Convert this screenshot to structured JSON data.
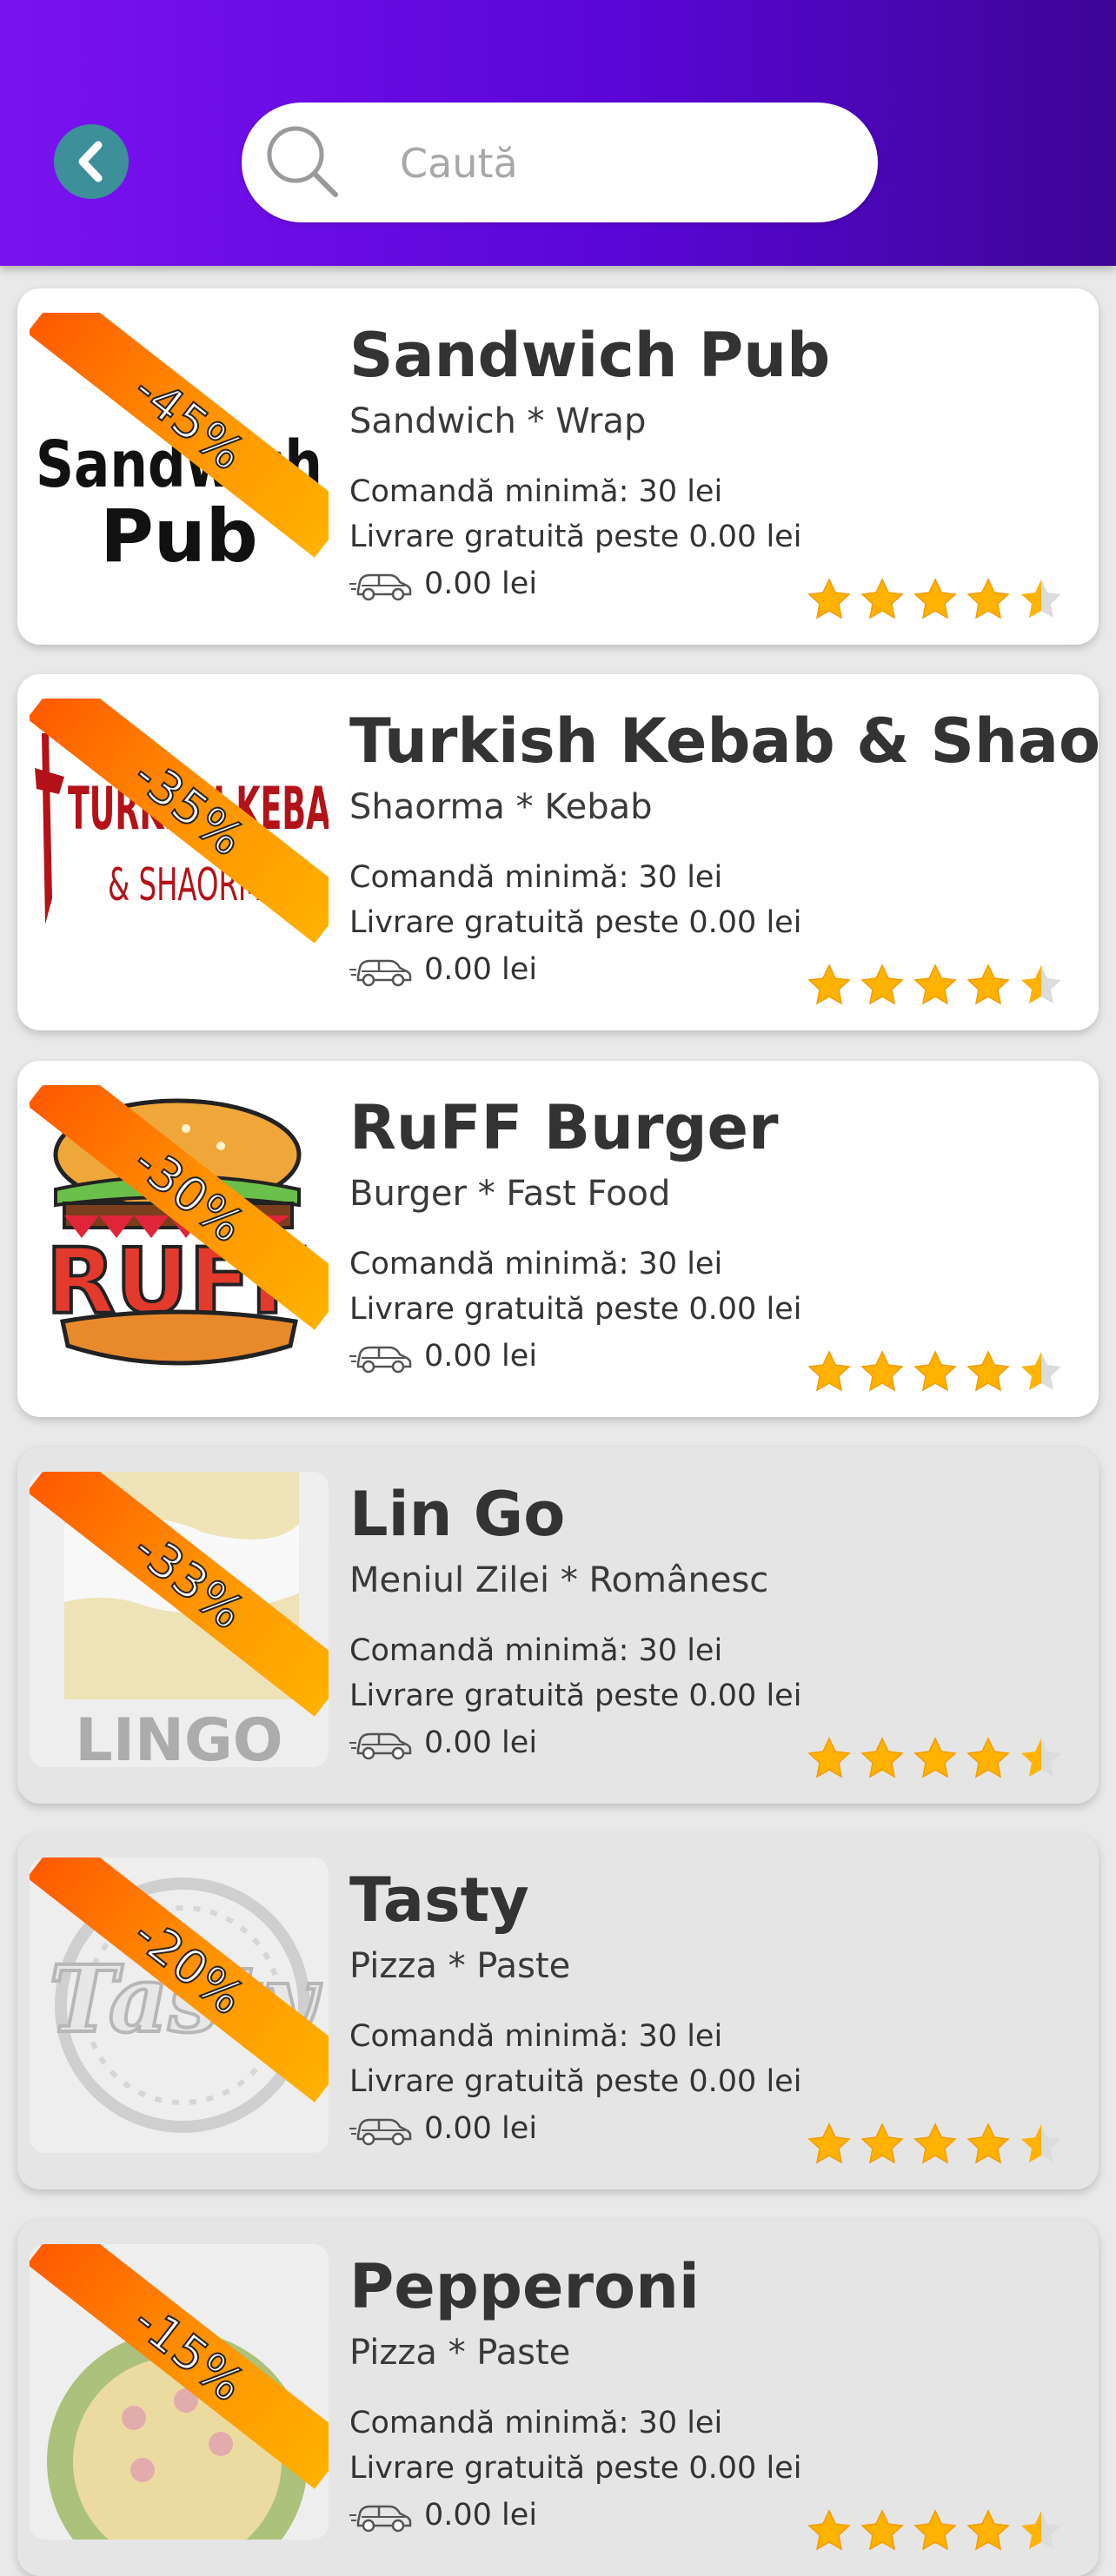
{
  "search": {
    "placeholder": "Caută"
  },
  "restaurants": [
    {
      "name": "Sandwich Pub",
      "categories": "Sandwich * Wrap",
      "discount": "-45%",
      "min_order": "Comandă minimă: 30 lei",
      "free_delivery": "Livrare gratuită peste 0.00 lei",
      "delivery_fee": "0.00 lei",
      "rating": 4.5,
      "open": true,
      "logo": "sandwich-pub-logo"
    },
    {
      "name": "Turkish Kebab & Shaorma",
      "categories": "Shaorma * Kebab",
      "discount": "-35%",
      "min_order": "Comandă minimă: 30 lei",
      "free_delivery": "Livrare gratuită peste 0.00 lei",
      "delivery_fee": "0.00 lei",
      "rating": 4.5,
      "open": true,
      "logo": "turkish-kebab-logo"
    },
    {
      "name": "RuFF Burger",
      "categories": "Burger * Fast Food",
      "discount": "-30%",
      "min_order": "Comandă minimă: 30 lei",
      "free_delivery": "Livrare gratuită peste 0.00 lei",
      "delivery_fee": "0.00 lei",
      "rating": 4.5,
      "open": true,
      "logo": "ruff-burger-logo"
    },
    {
      "name": "Lin Go",
      "categories": "Meniul Zilei * Românesc",
      "discount": "-33%",
      "min_order": "Comandă minimă: 30 lei",
      "free_delivery": "Livrare gratuită peste 0.00 lei",
      "delivery_fee": "0.00 lei",
      "rating": 4.5,
      "open": false,
      "logo": "lingo-logo"
    },
    {
      "name": "Tasty",
      "categories": "Pizza * Paste",
      "discount": "-20%",
      "min_order": "Comandă minimă: 30 lei",
      "free_delivery": "Livrare gratuită peste 0.00 lei",
      "delivery_fee": "0.00 lei",
      "rating": 4.5,
      "open": false,
      "logo": "tasty-logo"
    },
    {
      "name": "Pepperoni",
      "categories": "Pizza * Paste",
      "discount": "-15%",
      "min_order": "Comandă minimă: 30 lei",
      "free_delivery": "Livrare gratuită peste 0.00 lei",
      "delivery_fee": "0.00 lei",
      "rating": 4.5,
      "open": false,
      "logo": "pepperoni-logo"
    }
  ],
  "logo_text": {
    "sandwich_pub": [
      "Sandwich",
      "Pub"
    ],
    "turkish_kebab": [
      "TURKISH KEBAB",
      "& SHAORMA"
    ],
    "ruff": "RUFF",
    "lingo": "LINGO",
    "tasty": "Tasty"
  },
  "colors": {
    "header_start": "#7a12f0",
    "header_end": "#3d0596",
    "back_button": "#3d8f9a",
    "ribbon": "#ff8c00",
    "star": "#ffb300",
    "closed_card": "#e5e5e5"
  }
}
